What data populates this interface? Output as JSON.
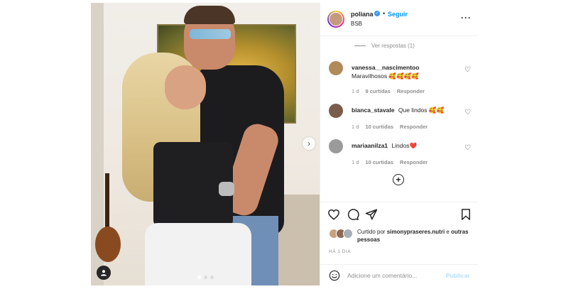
{
  "post": {
    "slide_dots": {
      "count": 3,
      "active_index": 0
    },
    "header": {
      "username": "poliana",
      "separator": "•",
      "follow_label": "Seguir",
      "location": "BSB",
      "more_icon": "more-horizontal-icon"
    },
    "view_replies": "Ver respostas (1)",
    "comments": [
      {
        "username": "vanessa__nascimentoo",
        "text": "Maravilhosos 🥰🥰🥰🥰",
        "time": "1 d",
        "likes": "9 curtidas",
        "reply_label": "Responder"
      },
      {
        "username": "bianca_stavale",
        "text": "Que lindos 🥰🥰",
        "time": "1 d",
        "likes": "10 curtidas",
        "reply_label": "Responder"
      },
      {
        "username": "mariaanilza1",
        "text": "Lindos❤️",
        "time": "1 d",
        "likes": "10 curtidas",
        "reply_label": "Responder"
      }
    ],
    "actions": {
      "liked_prefix": "Curtido por ",
      "liked_user": "simonypraseres.nutri",
      "liked_suffix": " e ",
      "liked_others": "outras pessoas",
      "time_ago": "HÁ 1 DIA"
    },
    "add_comment": {
      "placeholder": "Adicione um comentário...",
      "publish_label": "Publicar"
    },
    "colors": {
      "accent_blue": "#0095f6",
      "muted_text": "#8e8e8e",
      "publish_disabled": "#b2dffc"
    }
  }
}
